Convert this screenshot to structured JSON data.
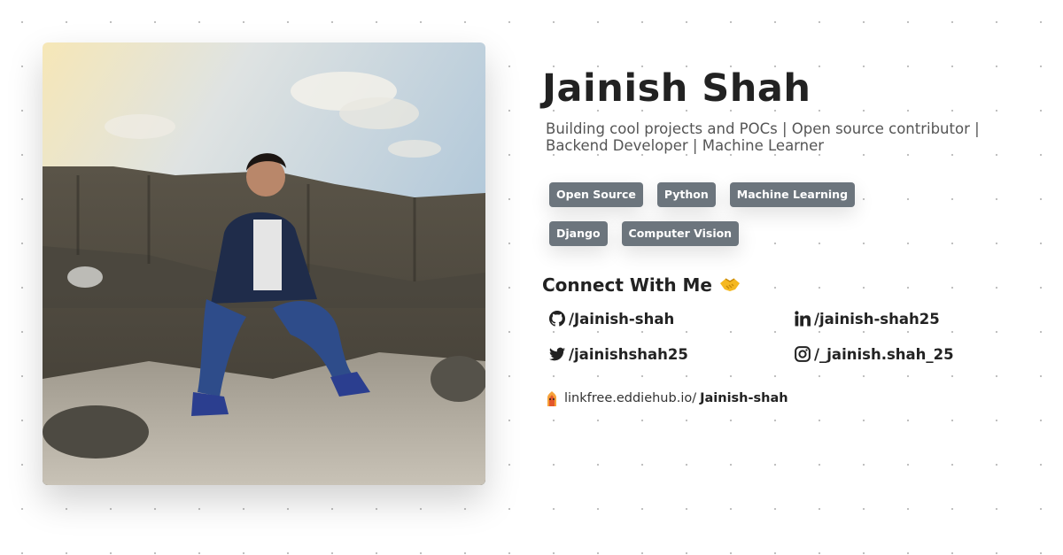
{
  "profile": {
    "name": "Jainish Shah",
    "bio": "Building cool projects and POCs | Open source contributor | Backend Developer | Machine Learner"
  },
  "tags": [
    "Open Source",
    "Python",
    "Machine Learning",
    "Django",
    "Computer Vision"
  ],
  "connect": {
    "title": "Connect With Me",
    "github": "/Jainish-shah",
    "linkedin": "/jainish-shah25",
    "twitter": "/jainishshah25",
    "instagram": "/_jainish.shah_25"
  },
  "linkfree": {
    "prefix": "linkfree.eddiehub.io/",
    "handle": "Jainish-shah"
  },
  "icons": [
    "github-icon",
    "linkedin-icon",
    "twitter-icon",
    "instagram-icon",
    "handshake-icon",
    "linkfree-icon"
  ],
  "colors": {
    "tag_bg": "#6c757d",
    "text": "#222222",
    "muted": "#555555"
  }
}
